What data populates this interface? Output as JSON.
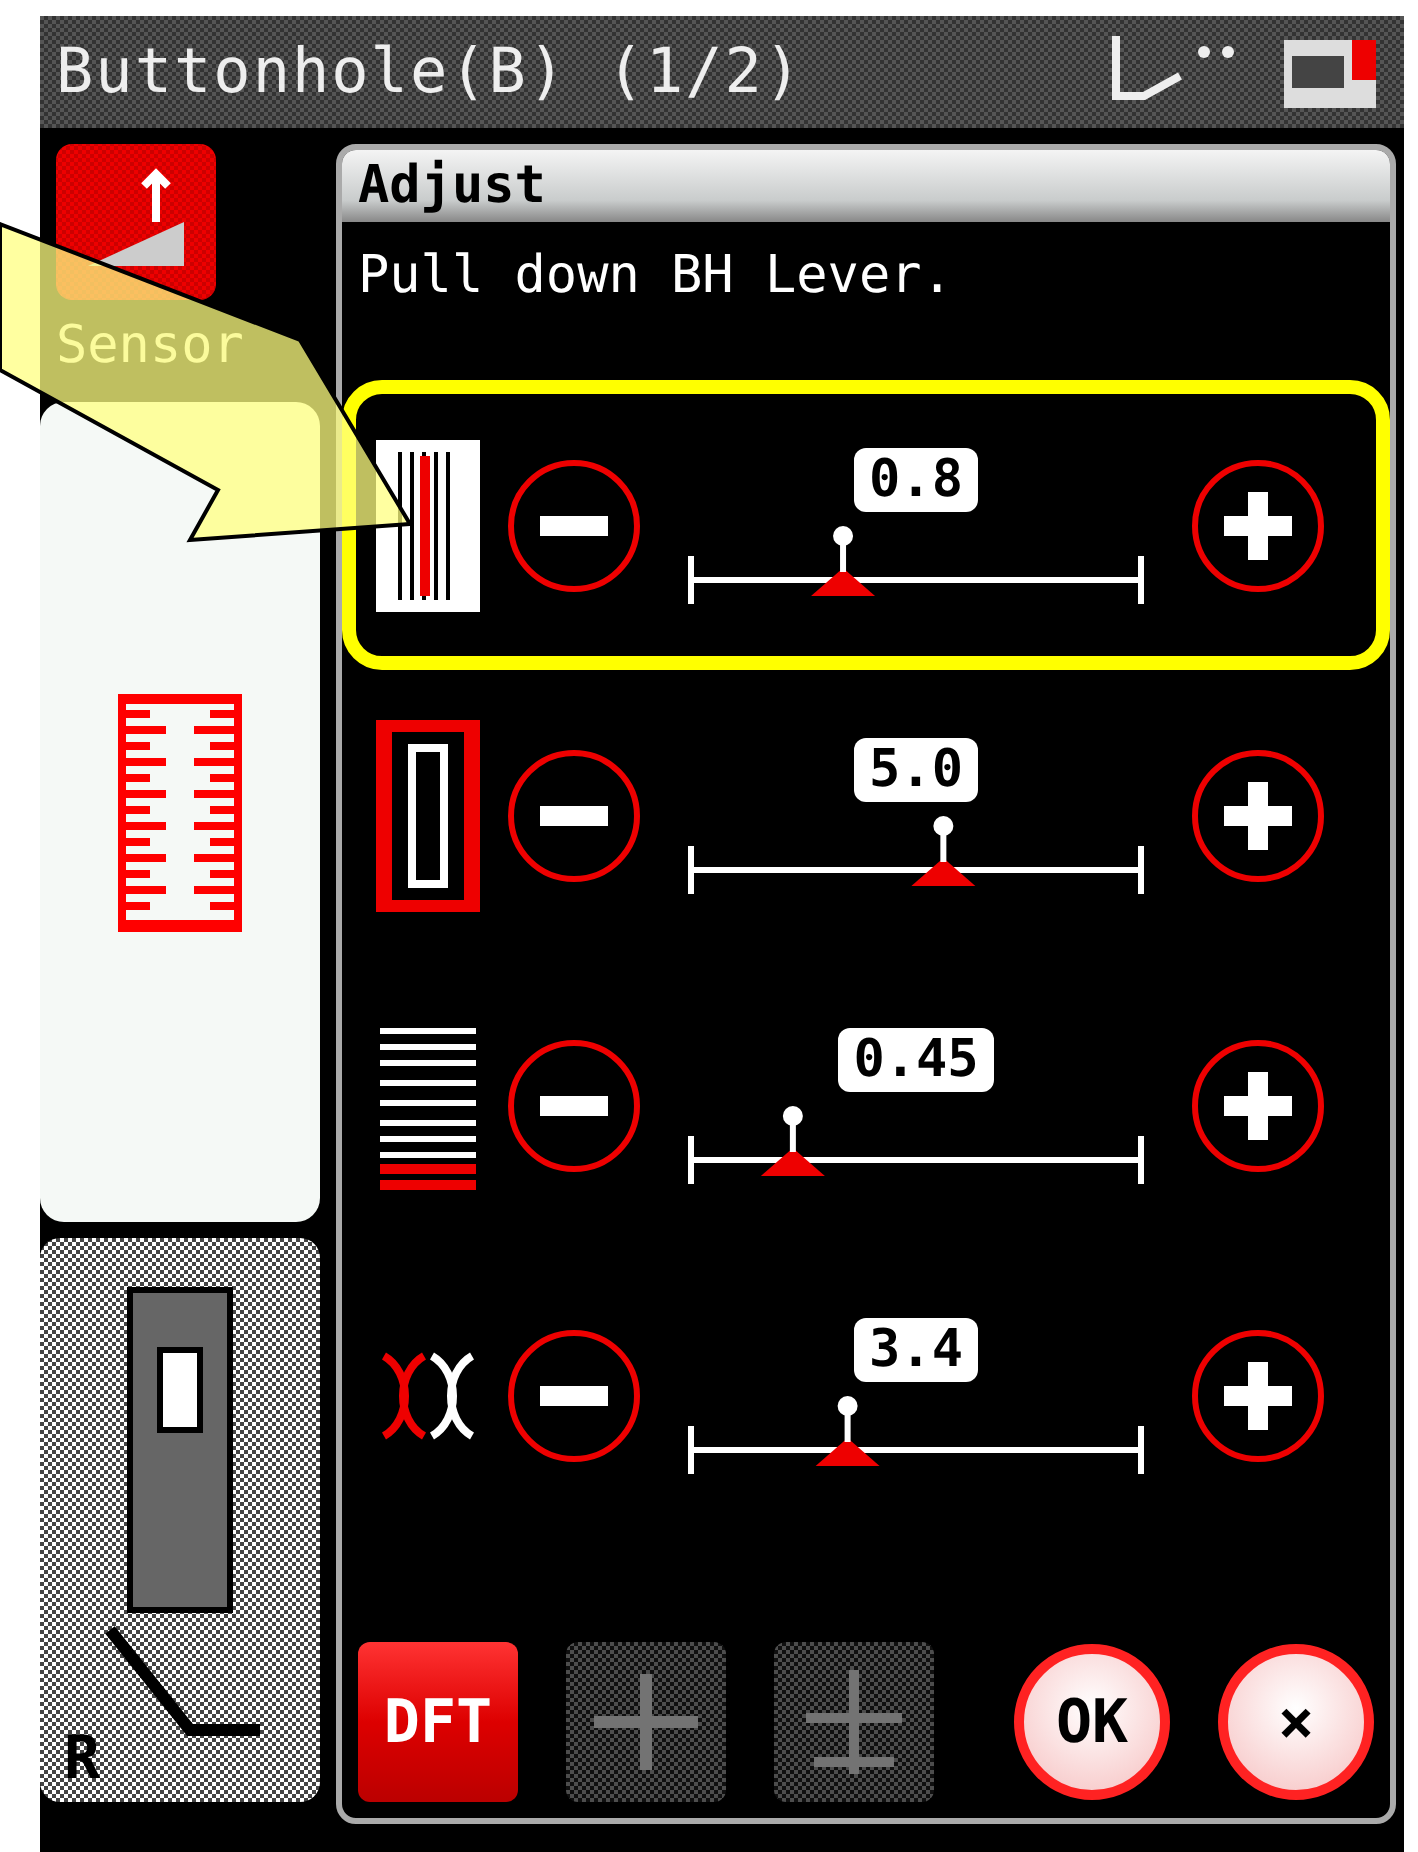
{
  "title_bar": {
    "title": "Buttonhole(B) (1/2)"
  },
  "sidebar": {
    "sensor_label": "Sensor",
    "foot_label": "R"
  },
  "panel": {
    "title": "Adjust",
    "message": "Pull down BH Lever."
  },
  "rows": [
    {
      "kind": "length",
      "value": "0.8",
      "level": 0.34,
      "highlighted": true
    },
    {
      "kind": "width",
      "value": "5.0",
      "level": 0.56,
      "highlighted": false
    },
    {
      "kind": "density",
      "value": "0.45",
      "level": 0.23,
      "highlighted": false
    },
    {
      "kind": "cut",
      "value": "3.4",
      "level": 0.35,
      "highlighted": false
    }
  ],
  "buttons": [
    {
      "kind": "default",
      "label": "DFT",
      "disabled": false
    },
    {
      "kind": "mirror",
      "disabled": true
    },
    {
      "kind": "flip",
      "disabled": true
    },
    {
      "kind": "ok",
      "label": "OK",
      "disabled": false
    },
    {
      "kind": "cancel",
      "label": "×",
      "disabled": false
    }
  ]
}
